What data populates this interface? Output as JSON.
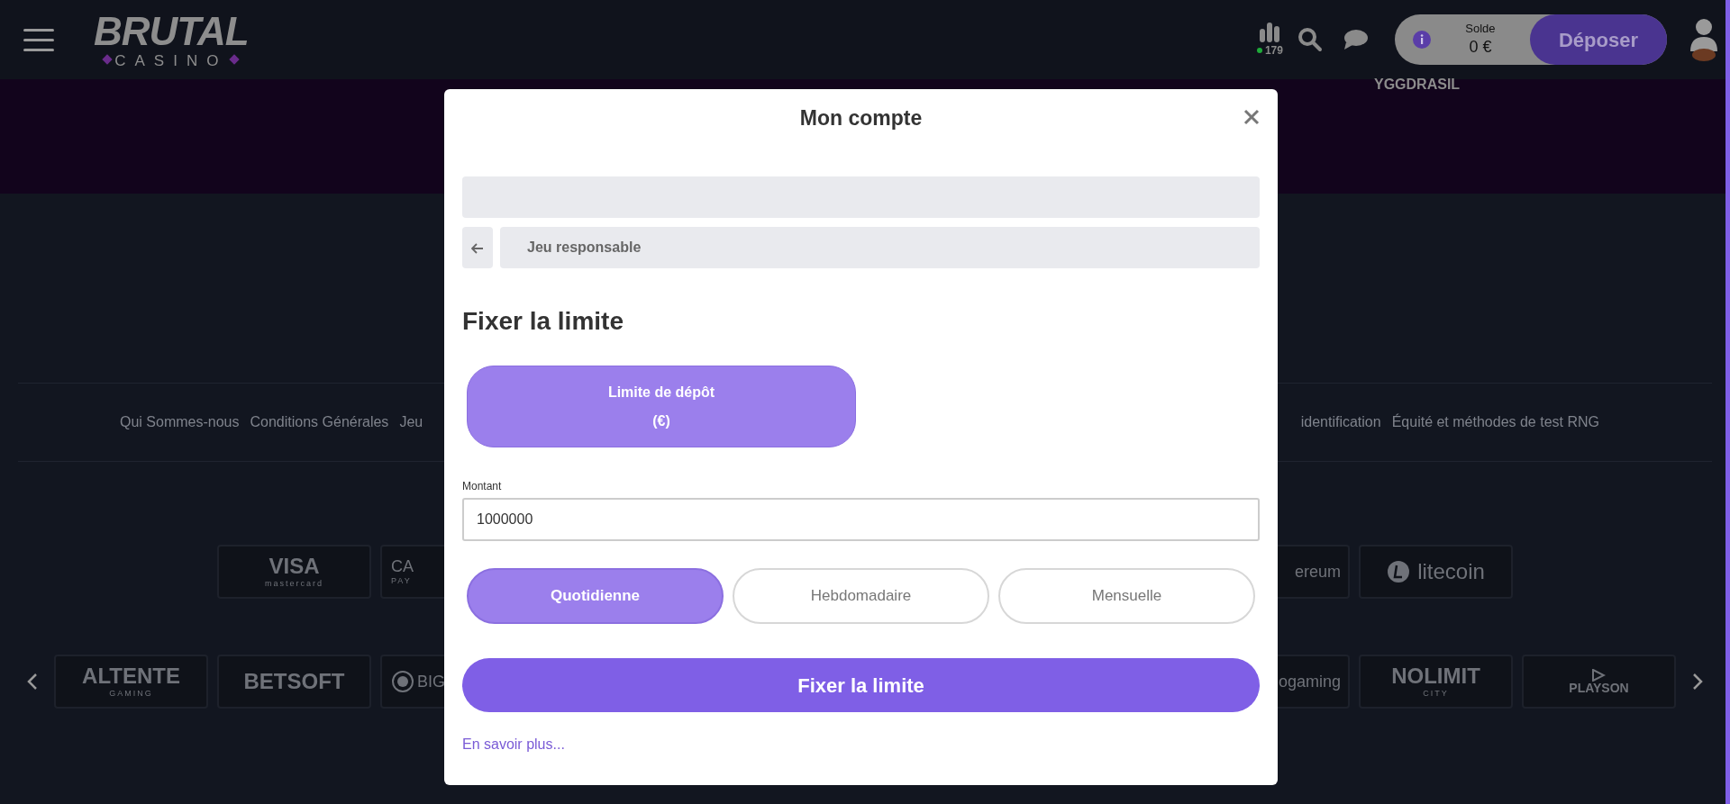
{
  "header": {
    "brand": {
      "name": "BRUTAL",
      "tagline": "CASINO"
    },
    "online_count": "179",
    "balance": {
      "label": "Solde",
      "amount": "0 €"
    },
    "deposit_button": "Déposer"
  },
  "banner": {
    "provider": "YGGDRASIL"
  },
  "footer_links_left": [
    "Qui Sommes-nous",
    "Conditions Générales",
    "Jeu"
  ],
  "footer_links_right": [
    "identification",
    "Équité et méthodes de test RNG"
  ],
  "payment_logos_left": [
    {
      "label": "VISA",
      "sublabel": "mastercard"
    },
    {
      "label": "CA",
      "sublabel": "PAY"
    }
  ],
  "payment_logos_right": [
    {
      "label": "ereum"
    },
    {
      "label": "litecoin",
      "kind": "coin"
    }
  ],
  "provider_logos_left": [
    {
      "label": "ALTENTE",
      "sublabel": "GAMING"
    },
    {
      "label": "BETSOFT"
    },
    {
      "label": "BIG",
      "kind": "round"
    }
  ],
  "provider_logos_right": [
    {
      "label": "ogaming"
    },
    {
      "label": "NOLIMIT",
      "sublabel": "CITY"
    },
    {
      "label": "PLAYSON",
      "kind": "play"
    }
  ],
  "modal": {
    "title": "Mon compte",
    "breadcrumb": "Jeu responsable",
    "heading": "Fixer la limite",
    "limit_types": [
      {
        "label": "Limite de dépôt",
        "unit": "(€)",
        "selected": true
      }
    ],
    "amount": {
      "label": "Montant",
      "value": "1000000"
    },
    "periods": [
      {
        "label": "Quotidienne",
        "selected": true
      },
      {
        "label": "Hebdomadaire",
        "selected": false
      },
      {
        "label": "Mensuelle",
        "selected": false
      }
    ],
    "submit": "Fixer la limite",
    "more_link": "En savoir plus..."
  }
}
